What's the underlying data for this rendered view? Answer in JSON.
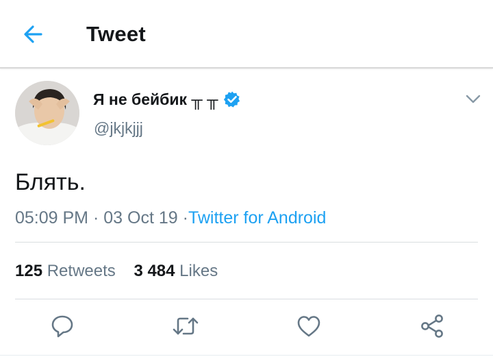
{
  "header": {
    "title": "Tweet",
    "back_icon": "arrow-left-icon"
  },
  "tweet": {
    "author": {
      "display_name": "Я не бейбик ╥ ╥",
      "handle": "@jkjkjjj",
      "verified": true,
      "verified_icon": "verified-badge-icon"
    },
    "text": "Блять.",
    "time": "05:09 PM",
    "date": "03 Oct 19",
    "separator": "·",
    "source": "Twitter for Android",
    "stats": {
      "retweets_count": "125",
      "retweets_label": "Retweets",
      "likes_count": "3 484",
      "likes_label": "Likes"
    },
    "actions": [
      "reply-icon",
      "retweet-icon",
      "like-icon",
      "share-icon"
    ]
  },
  "colors": {
    "accent": "#1da1f2",
    "secondary_text": "#657786",
    "primary_text": "#14171a",
    "divider": "#d9dde0"
  }
}
